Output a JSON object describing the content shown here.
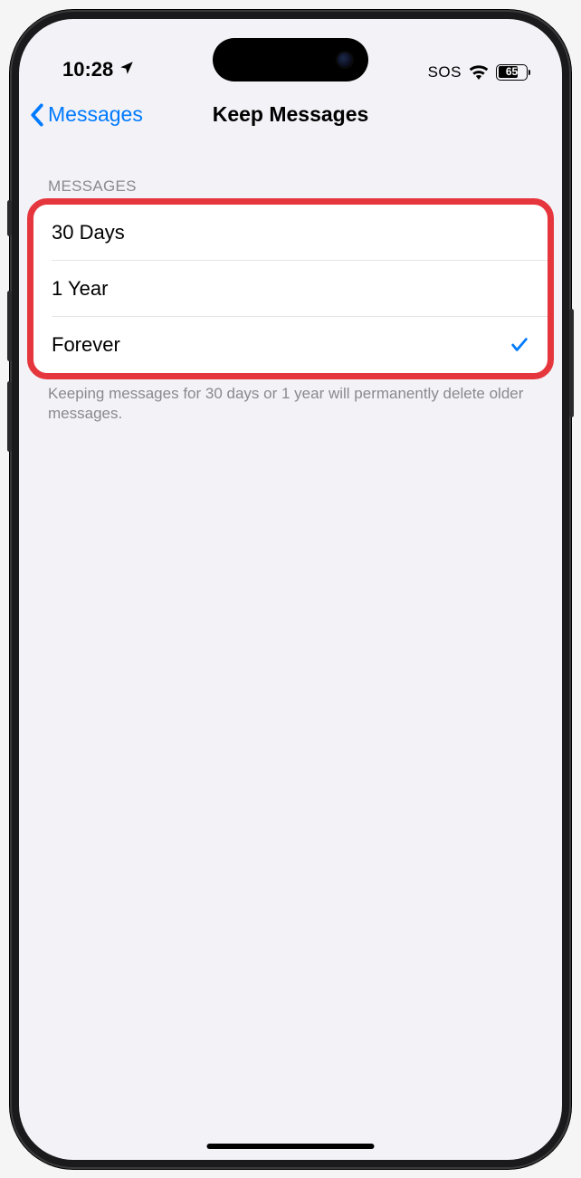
{
  "status_bar": {
    "time": "10:28",
    "sos": "SOS",
    "battery": "65"
  },
  "nav": {
    "back_label": "Messages",
    "title": "Keep Messages"
  },
  "section": {
    "header": "MESSAGES",
    "options": [
      {
        "label": "30 Days",
        "selected": false
      },
      {
        "label": "1 Year",
        "selected": false
      },
      {
        "label": "Forever",
        "selected": true
      }
    ],
    "footer": "Keeping messages for 30 days or 1 year will permanently delete older messages."
  }
}
